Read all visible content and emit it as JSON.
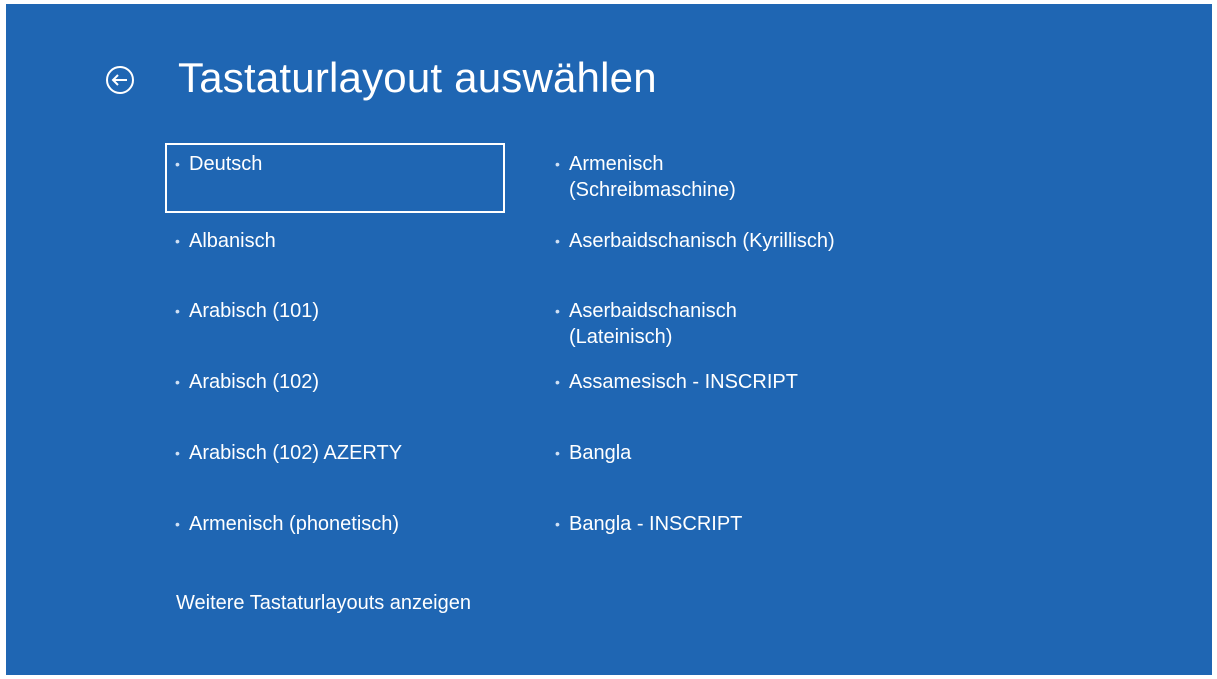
{
  "page": {
    "background_color": "#1f66b3",
    "text_color": "#ffffff",
    "title": "Tastaturlayout auswählen",
    "back_icon": "back-arrow-circle-icon"
  },
  "layouts": {
    "column1": [
      {
        "label": "Deutsch",
        "selected": true
      },
      {
        "label": "Albanisch",
        "selected": false
      },
      {
        "label": "Arabisch (101)",
        "selected": false
      },
      {
        "label": "Arabisch (102)",
        "selected": false
      },
      {
        "label": "Arabisch (102) AZERTY",
        "selected": false
      },
      {
        "label": "Armenisch (phonetisch)",
        "selected": false
      }
    ],
    "column2": [
      {
        "label": "Armenisch (Schreibmaschine)",
        "selected": false
      },
      {
        "label": "Aserbaidschanisch (Kyrillisch)",
        "selected": false
      },
      {
        "label": "Aserbaidschanisch (Lateinisch)",
        "selected": false
      },
      {
        "label": "Assamesisch - INSCRIPT",
        "selected": false
      },
      {
        "label": "Bangla",
        "selected": false
      },
      {
        "label": "Bangla - INSCRIPT",
        "selected": false
      }
    ]
  },
  "more_link": "Weitere Tastaturlayouts anzeigen"
}
